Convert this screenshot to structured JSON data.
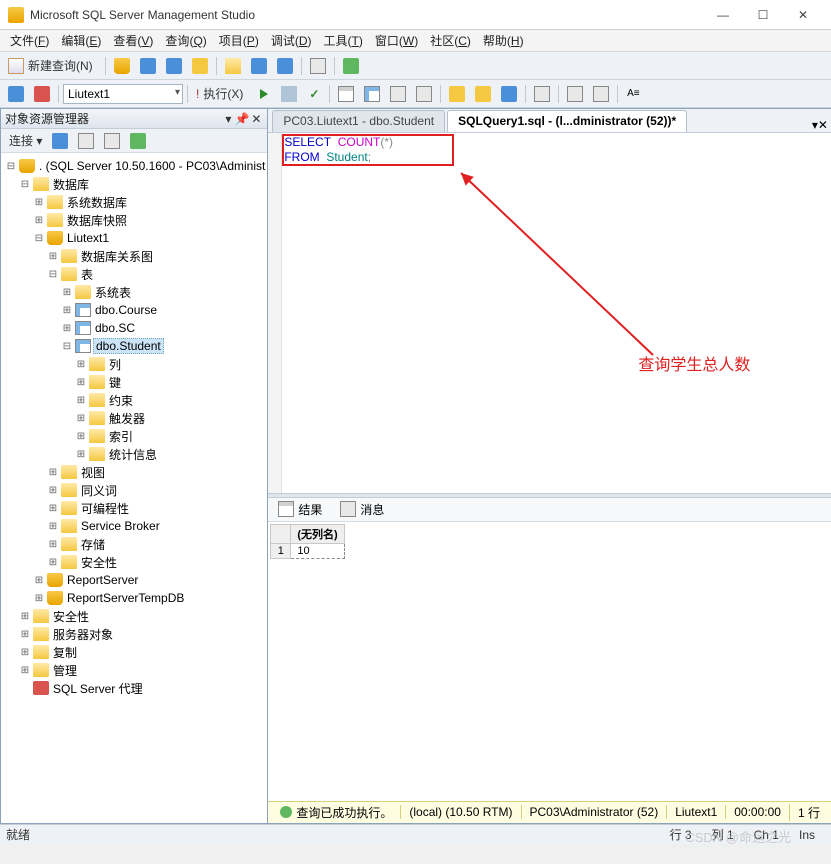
{
  "app": {
    "title": "Microsoft SQL Server Management Studio"
  },
  "menus": [
    {
      "label": "文件",
      "hot": "F"
    },
    {
      "label": "编辑",
      "hot": "E"
    },
    {
      "label": "查看",
      "hot": "V"
    },
    {
      "label": "查询",
      "hot": "Q"
    },
    {
      "label": "项目",
      "hot": "P"
    },
    {
      "label": "调试",
      "hot": "D"
    },
    {
      "label": "工具",
      "hot": "T"
    },
    {
      "label": "窗口",
      "hot": "W"
    },
    {
      "label": "社区",
      "hot": "C"
    },
    {
      "label": "帮助",
      "hot": "H"
    }
  ],
  "toolbar1": {
    "newquery": "新建查询(N)"
  },
  "toolbar2": {
    "combo": "Liutext1",
    "execute": "执行(X)"
  },
  "explorer": {
    "title": "对象资源管理器",
    "connect": "连接 ▾",
    "root": ". (SQL Server 10.50.1600 - PC03\\Administ",
    "n_dbroot": "数据库",
    "n_sysdb": "系统数据库",
    "n_snap": "数据库快照",
    "n_db": "Liutext1",
    "n_diag": "数据库关系图",
    "n_tables": "表",
    "n_systab": "系统表",
    "n_course": "dbo.Course",
    "n_sc": "dbo.SC",
    "n_student": "dbo.Student",
    "n_cols": "列",
    "n_keys": "键",
    "n_cons": "约束",
    "n_trig": "触发器",
    "n_idx": "索引",
    "n_stat": "统计信息",
    "n_views": "视图",
    "n_syn": "同义词",
    "n_prog": "可编程性",
    "n_sb": "Service Broker",
    "n_store": "存储",
    "n_sec": "安全性",
    "n_rs": "ReportServer",
    "n_rstmp": "ReportServerTempDB",
    "n_sec2": "安全性",
    "n_svrobj": "服务器对象",
    "n_repl": "复制",
    "n_mgmt": "管理",
    "n_agent": "SQL Server 代理"
  },
  "tabs": {
    "t1": "PC03.Liutext1 - dbo.Student",
    "t2": "SQLQuery1.sql - (l...dministrator (52))*"
  },
  "sql": {
    "l1_kw1": "SELECT",
    "l1_fn": "COUNT",
    "l1_op": "(*)",
    "l2_kw": "FROM",
    "l2_tbl": "Student",
    "l2_end": ";",
    "annotation": "查询学生总人数"
  },
  "results": {
    "tab1": "结果",
    "tab2": "消息",
    "header": "(无列名)",
    "rownum": "1",
    "value": "10"
  },
  "status": {
    "msg": "查询已成功执行。",
    "server": "(local) (10.50 RTM)",
    "user": "PC03\\Administrator (52)",
    "db": "Liutext1",
    "time": "00:00:00",
    "rows": "1 行"
  },
  "bottom": {
    "ready": "就绪",
    "line": "行 3",
    "col": "列 1",
    "ch": "Ch 1",
    "ins": "Ins"
  },
  "watermark": "CSDN @命运之光"
}
